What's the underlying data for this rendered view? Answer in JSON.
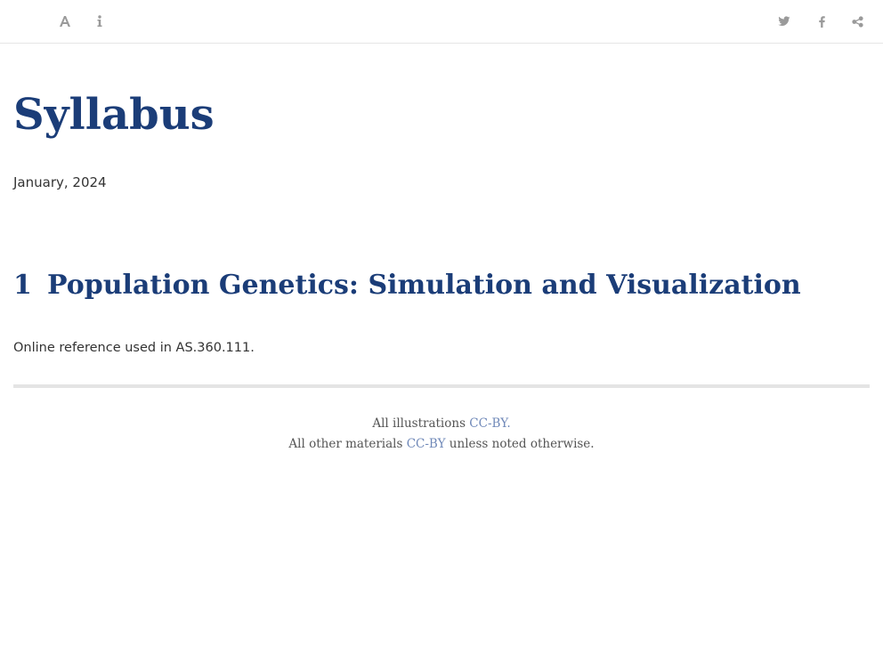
{
  "toolbar": {
    "left_icons": [
      "font-settings-icon",
      "info-icon"
    ],
    "right_icons": [
      "twitter-icon",
      "facebook-icon",
      "share-icon"
    ],
    "icon_color": "#9a9a9a"
  },
  "page": {
    "title": "Syllabus",
    "date": "January, 2024",
    "title_color": "#1b3d78"
  },
  "section": {
    "number": "1",
    "heading": "Population Genetics: Simulation and Visualization",
    "body": "Online reference used in AS.360.111."
  },
  "footer": {
    "line1_text": "All illustrations ",
    "line1_link": "CC-BY.",
    "line2_text": "All other materials ",
    "line2_link": "CC-BY",
    "line2_suffix": " unless noted otherwise.",
    "link_color": "#6f88b8"
  }
}
